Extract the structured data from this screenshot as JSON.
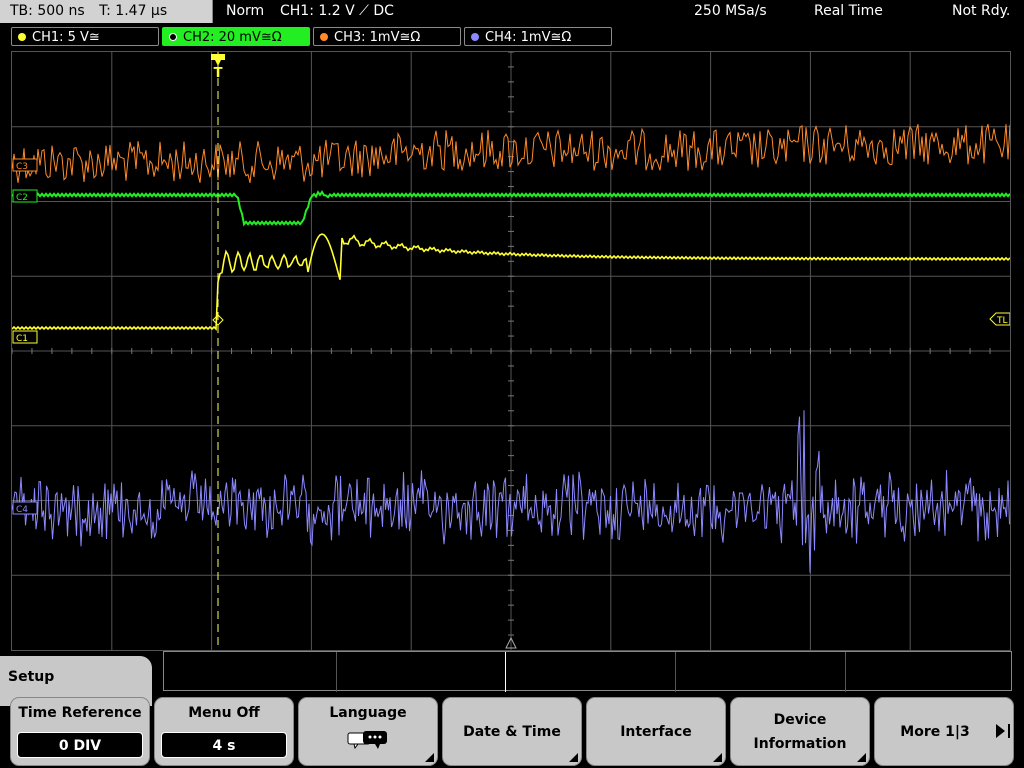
{
  "top_bar": {
    "tb": "TB: 500 ns",
    "t": "T: 1.47 µs",
    "mode": "Norm",
    "ch1_trigger": "CH1: 1.2 V ⟋ DC",
    "sample_rate": "250 MSa/s",
    "acq_mode": "Real Time",
    "status": "Not Rdy."
  },
  "channels": [
    {
      "label": "CH1: 5 V≅",
      "color": "#ffff33",
      "active": false
    },
    {
      "label": "CH2: 20 mV≅Ω",
      "color": "#22ee22",
      "active": true
    },
    {
      "label": "CH3: 1mV≅Ω",
      "color": "#ff8a2a",
      "active": false
    },
    {
      "label": "CH4: 1mV≅Ω",
      "color": "#8c88ff",
      "active": false
    }
  ],
  "markers": {
    "c1": "C1",
    "c2": "C2",
    "c3": "C3",
    "c4": "C4",
    "trigger_level": "TL",
    "trigger_position": "T"
  },
  "waveform_colors": {
    "ch1": "#ffff33",
    "ch2": "#22ee22",
    "ch3": "#ff8a2a",
    "ch4": "#8c88ff",
    "grid": "#555555",
    "trigger": "#ffff66"
  },
  "setup_tab": "Setup",
  "softkeys": [
    {
      "label": "Time Reference",
      "value": "0 DIV"
    },
    {
      "label": "Menu Off",
      "value": "4 s"
    },
    {
      "label": "Language",
      "icon": "speech-bubbles-icon"
    },
    {
      "label": "Date & Time"
    },
    {
      "label": "Interface"
    },
    {
      "line1": "Device",
      "line2": "Information"
    },
    {
      "label": "More 1|3"
    }
  ]
}
